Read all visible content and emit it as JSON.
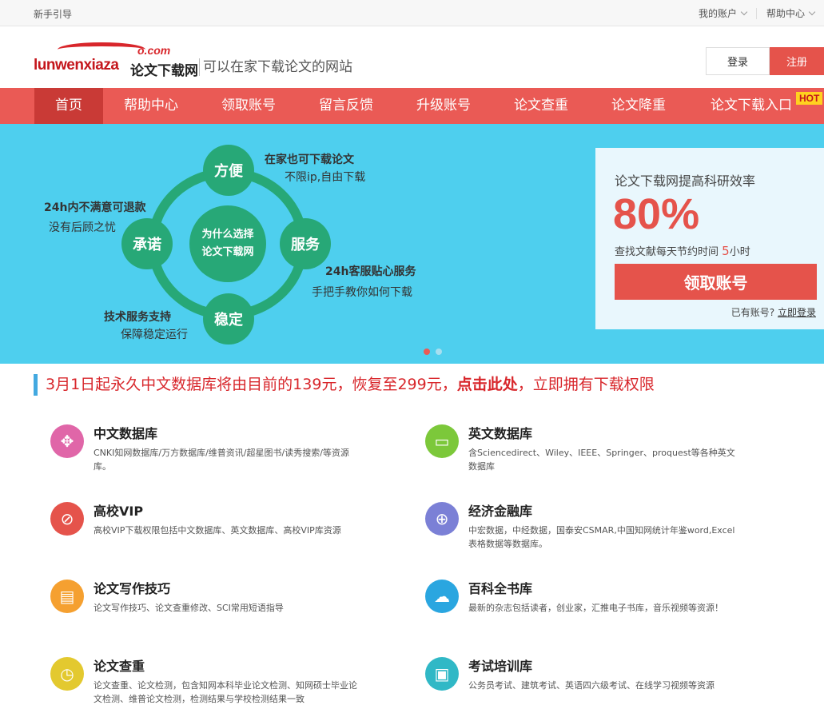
{
  "topbar": {
    "guide": "新手引导",
    "account": "我的账户",
    "help": "帮助中心"
  },
  "header": {
    "logo_en": "lunwenxiaza",
    "logo_com": "o.com",
    "logo_cn": "论文下载网",
    "slogan": "可以在家下载论文的网站",
    "login": "登录",
    "register": "注册"
  },
  "nav": {
    "items": [
      "首页",
      "帮助中心",
      "领取账号",
      "留言反馈",
      "升级账号",
      "论文查重",
      "论文降重",
      "论文下载入口"
    ],
    "hot": "HOT"
  },
  "banner": {
    "center": [
      "为什么选择",
      "论文下载网"
    ],
    "nodes": {
      "top": "方便",
      "left": "承诺",
      "right": "服务",
      "bottom": "稳定"
    },
    "texts": {
      "tr_title": "在家也可下载论文",
      "tr_sub": "不限ip,自由下载",
      "tl_title": "24h内不满意可退款",
      "tl_sub": "没有后顾之忧",
      "r_title": "24h客服贴心服务",
      "r_sub": "手把手教你如何下载",
      "bl_title": "技术服务支持",
      "bl_sub": "保障稳定运行"
    },
    "card": {
      "title": "论文下载网提高科研效率",
      "percent": "80%",
      "save_pre": "查找文献每天节约时间",
      "save_num": "5",
      "save_post": "小时",
      "cta": "领取账号",
      "have": "已有账号?",
      "login_now": "立即登录"
    }
  },
  "notice": {
    "pre": "3月1日起永久中文数据库将由目前的139元，恢复至299元，",
    "link": "点击此处",
    "post": "，立即拥有下载权限"
  },
  "features": [
    {
      "title": "中文数据库",
      "desc": "CNKI知网数据库/万方数据库/维普资讯/超星图书/读秀搜索/等资源库。",
      "icon": "move-arrows-icon",
      "color": "#e066a8"
    },
    {
      "title": "英文数据库",
      "desc": "含Sciencedirect、Wiley、IEEE、Springer、proquest等各种英文数据库",
      "icon": "monitor-icon",
      "color": "#7cc83a"
    },
    {
      "title": "高校VIP",
      "desc": "高校VIP下载权限包括中文数据库、英文数据库、高校VIP库资源",
      "icon": "ban-icon",
      "color": "#e5534b"
    },
    {
      "title": "经济金融库",
      "desc": "中宏数据，中经数据，国泰安CSMAR,中国知网统计年鉴word,Excel表格数据等数据库。",
      "icon": "globe-icon",
      "color": "#7b80d6"
    },
    {
      "title": "论文写作技巧",
      "desc": "论文写作技巧、论文查重修改、SCI常用短语指导",
      "icon": "film-icon",
      "color": "#f5a030"
    },
    {
      "title": "百科全书库",
      "desc": "最新的杂志包括读者，创业家，汇推电子书库，音乐视频等资源！",
      "icon": "cloud-bolt-icon",
      "color": "#2aa6e0"
    },
    {
      "title": "论文查重",
      "desc": "论文查重、论文检测，包含知网本科毕业论文检测、知网硕士毕业论文检测、维普论文检测，检测结果与学校检测结果一致",
      "icon": "clock-icon",
      "color": "#e3c92f"
    },
    {
      "title": "考试培训库",
      "desc": "公务员考试、建筑考试、英语四六级考试、在线学习视频等资源",
      "icon": "briefcase-icon",
      "color": "#30b8c6"
    }
  ]
}
